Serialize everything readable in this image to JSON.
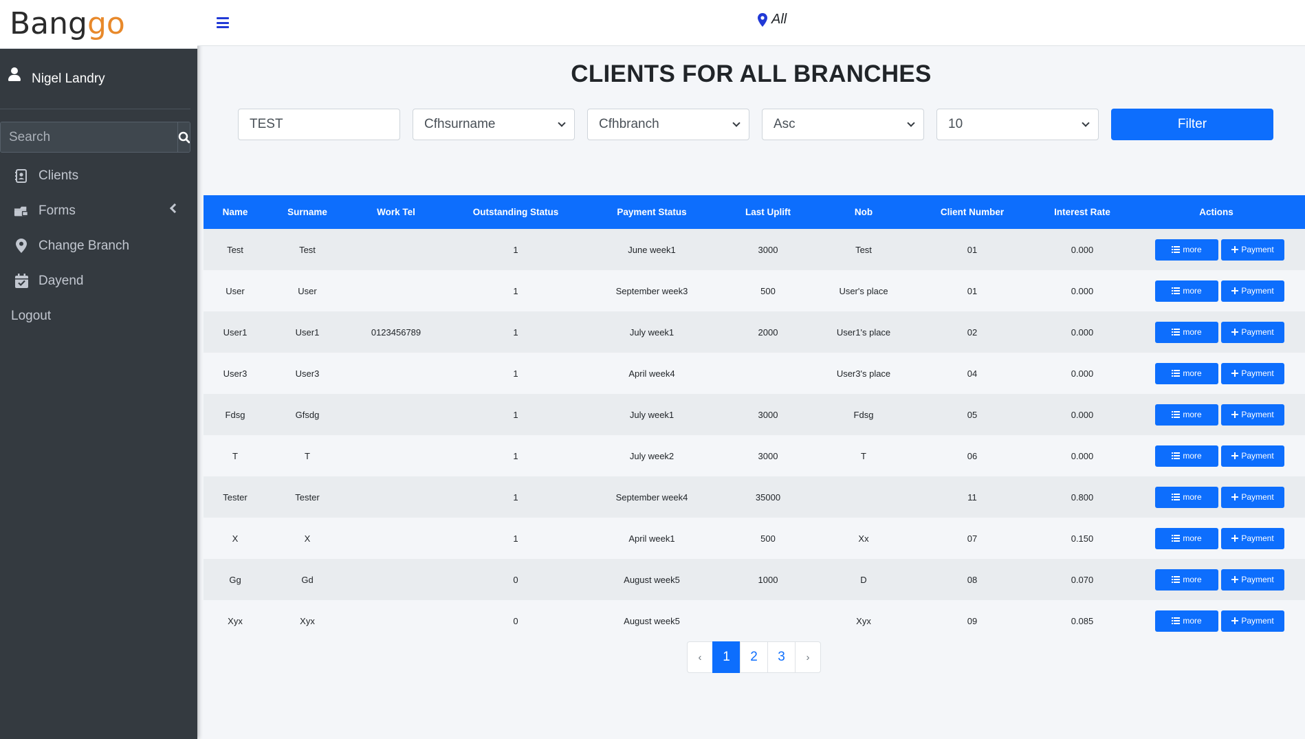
{
  "brand": {
    "text_main": "Bang",
    "text_accent": "go"
  },
  "user": {
    "name": "Nigel Landry"
  },
  "sidebar": {
    "search_placeholder": "Search",
    "items": [
      {
        "label": "Clients",
        "icon": "address-book-icon"
      },
      {
        "label": "Forms",
        "icon": "forms-icon"
      },
      {
        "label": "Change Branch",
        "icon": "map-marker-icon"
      },
      {
        "label": "Dayend",
        "icon": "calendar-check-icon"
      }
    ],
    "logout_label": "Logout"
  },
  "header": {
    "branch_label": "All"
  },
  "page": {
    "title": "CLIENTS FOR ALL BRANCHES"
  },
  "filters": {
    "search_value": "TEST",
    "sort_field": "Cfhsurname",
    "branch_field": "Cfhbranch",
    "order": "Asc",
    "per_page": "10",
    "filter_label": "Filter"
  },
  "table": {
    "columns": [
      "Name",
      "Surname",
      "Work Tel",
      "Outstanding Status",
      "Payment Status",
      "Last Uplift",
      "Nob",
      "Client Number",
      "Interest Rate",
      "Actions"
    ],
    "more_label": "more",
    "payment_label": "Payment",
    "rows": [
      [
        "Test",
        "Test",
        "",
        "1",
        "June week1",
        "3000",
        "Test",
        "01",
        "0.000"
      ],
      [
        "User",
        "User",
        "",
        "1",
        "September week3",
        "500",
        "User's place",
        "01",
        "0.000"
      ],
      [
        "User1",
        "User1",
        "0123456789",
        "1",
        "July week1",
        "2000",
        "User1's place",
        "02",
        "0.000"
      ],
      [
        "User3",
        "User3",
        "",
        "1",
        "April week4",
        "",
        "User3's place",
        "04",
        "0.000"
      ],
      [
        "Fdsg",
        "Gfsdg",
        "",
        "1",
        "July week1",
        "3000",
        "Fdsg",
        "05",
        "0.000"
      ],
      [
        "T",
        "T",
        "",
        "1",
        "July week2",
        "3000",
        "T",
        "06",
        "0.000"
      ],
      [
        "Tester",
        "Tester",
        "",
        "1",
        "September week4",
        "35000",
        "",
        "11",
        "0.800"
      ],
      [
        "X",
        "X",
        "",
        "1",
        "April week1",
        "500",
        "Xx",
        "07",
        "0.150"
      ],
      [
        "Gg",
        "Gd",
        "",
        "0",
        "August week5",
        "1000",
        "D",
        "08",
        "0.070"
      ],
      [
        "Xyx",
        "Xyx",
        "",
        "0",
        "August week5",
        "",
        "Xyx",
        "09",
        "0.085"
      ]
    ]
  },
  "pagination": {
    "prev": "‹",
    "next": "›",
    "pages": [
      "1",
      "2",
      "3"
    ],
    "active": "1"
  },
  "colors": {
    "primary": "#0d6efd",
    "sidebar": "#343a40",
    "brand_accent": "#e8892b"
  }
}
